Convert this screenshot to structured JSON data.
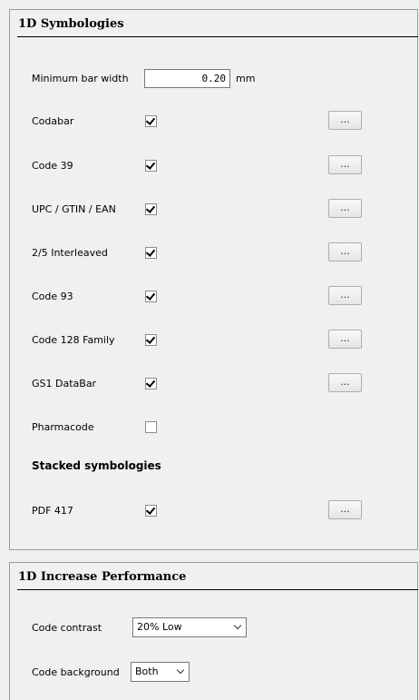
{
  "symbologies": {
    "title": "1D Symbologies",
    "min_bar_width": {
      "label": "Minimum bar width",
      "value": "0.20",
      "unit": "mm"
    },
    "rows": [
      {
        "label": "Codabar",
        "checked": true,
        "button": "..."
      },
      {
        "label": "Code 39",
        "checked": true,
        "button": "..."
      },
      {
        "label": "UPC / GTIN / EAN",
        "checked": true,
        "button": "..."
      },
      {
        "label": "2/5 Interleaved",
        "checked": true,
        "button": "..."
      },
      {
        "label": "Code 93",
        "checked": true,
        "button": "..."
      },
      {
        "label": "Code 128 Family",
        "checked": true,
        "button": "..."
      },
      {
        "label": "GS1 DataBar",
        "checked": true,
        "button": "..."
      },
      {
        "label": "Pharmacode",
        "checked": false
      }
    ],
    "stacked_heading": "Stacked symbologies",
    "stacked_rows": [
      {
        "label": "PDF 417",
        "checked": true,
        "button": "..."
      }
    ]
  },
  "performance": {
    "title": "1D Increase Performance",
    "code_contrast": {
      "label": "Code contrast",
      "value": "20% Low"
    },
    "code_background": {
      "label": "Code background",
      "value": "Both"
    }
  }
}
